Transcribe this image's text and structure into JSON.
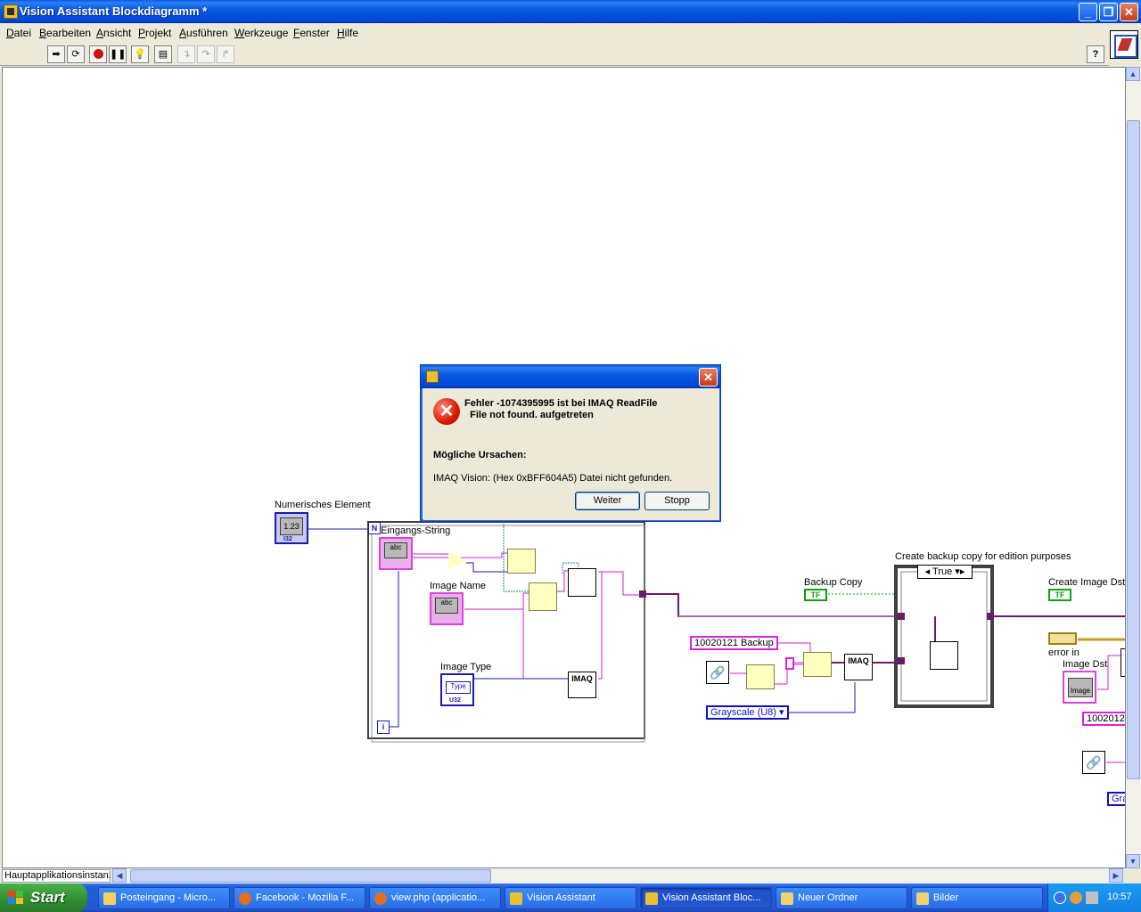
{
  "window": {
    "title": "Vision Assistant Blockdiagramm *",
    "caption_buttons": {
      "minimize": "_",
      "restore": "❐",
      "close": "✕"
    }
  },
  "menubar": {
    "items": [
      "Datei",
      "Bearbeiten",
      "Ansicht",
      "Projekt",
      "Ausführen",
      "Werkzeuge",
      "Fenster",
      "Hilfe"
    ]
  },
  "toolbar": {
    "help_label": "?",
    "buttons": [
      "run-icon",
      "run-continuously-icon",
      "abort-icon",
      "pause-icon",
      "highlight-execution-icon",
      "retain-wire-values-icon",
      "step-into-icon",
      "step-over-icon",
      "step-out-icon"
    ]
  },
  "diagram": {
    "numeric_label": "Numerisches Element",
    "numeric_value": "1.23",
    "numeric_type": "I32",
    "loop_count": "N",
    "loop_iteration": "i",
    "input_string_label": "Eingangs-String",
    "image_name_label": "Image Name",
    "image_type_label": "Image Type",
    "string_glyph": "abc",
    "type_glyph": "Type",
    "type_type": "U32",
    "imaq_label": "IMAQ",
    "backup_const": "10020121 Backup",
    "grayscale_enum": "Grayscale (U8)",
    "backup_copy_label": "Backup Copy",
    "tf_glyph": "TF",
    "case_label": "Create backup copy for edition purposes",
    "case_selector": "True",
    "create_image_dst_label": "Create Image Dst",
    "error_in_label": "error in",
    "image_dst_label": "Image Dst",
    "image_glyph": "Image",
    "const_cut": "1002012",
    "gra_cut": "Gra"
  },
  "dialog": {
    "title": "",
    "error_line1": "Fehler -1074395995 ist bei IMAQ ReadFile",
    "error_line2": "  File not found. aufgetreten",
    "causes_heading": "Mögliche Ursachen:",
    "causes_text": "IMAQ Vision:  (Hex 0xBFF604A5) Datei nicht gefunden.",
    "continue_button": "Weiter",
    "stop_button": "Stopp"
  },
  "statusbar": {
    "context": "Hauptapplikationsinstanz"
  },
  "taskbar": {
    "start_label": "Start",
    "items": [
      {
        "label": "Posteingang - Micro...",
        "icon": "outlook-icon"
      },
      {
        "label": "Facebook - Mozilla F...",
        "icon": "firefox-icon"
      },
      {
        "label": "view.php (applicatio...",
        "icon": "firefox-icon"
      },
      {
        "label": "Vision Assistant",
        "icon": "labview-icon"
      },
      {
        "label": "Vision Assistant Bloc...",
        "icon": "labview-icon"
      },
      {
        "label": "Neuer Ordner",
        "icon": "folder-icon"
      },
      {
        "label": "Bilder",
        "icon": "folder-icon"
      }
    ],
    "clock": "10:57"
  },
  "colors": {
    "wire_pink": "#d020d0",
    "wire_blue": "#1a1ab0",
    "wire_purple": "#6a1a6a",
    "wire_green": "#10a010",
    "wire_teal": "#208080",
    "titlebar_blue": "#0a5ae0"
  }
}
